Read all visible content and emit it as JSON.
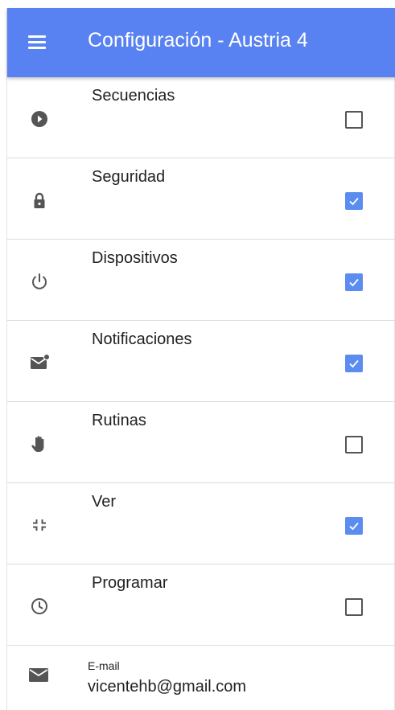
{
  "appbar": {
    "title": "Configuración - Austria 4",
    "background_color": "#5882f2",
    "menu_icon": "menu-icon"
  },
  "settings": [
    {
      "label": "Secuencias",
      "icon": "play-circle-icon",
      "checked": false
    },
    {
      "label": "Seguridad",
      "icon": "lock-icon",
      "checked": true
    },
    {
      "label": "Dispositivos",
      "icon": "power-icon",
      "checked": true
    },
    {
      "label": "Notificaciones",
      "icon": "mail-notification-icon",
      "checked": true
    },
    {
      "label": "Rutinas",
      "icon": "hand-icon",
      "checked": false
    },
    {
      "label": "Ver",
      "icon": "fullscreen-exit-icon",
      "checked": true
    },
    {
      "label": "Programar",
      "icon": "clock-icon",
      "checked": false
    }
  ],
  "email": {
    "label": "E-mail",
    "value": "vicentehb@gmail.com",
    "icon": "mail-icon"
  },
  "colors": {
    "checkbox_checked": "#5b8cf0",
    "checkbox_unchecked_border": "#555555",
    "icon": "#555555"
  }
}
